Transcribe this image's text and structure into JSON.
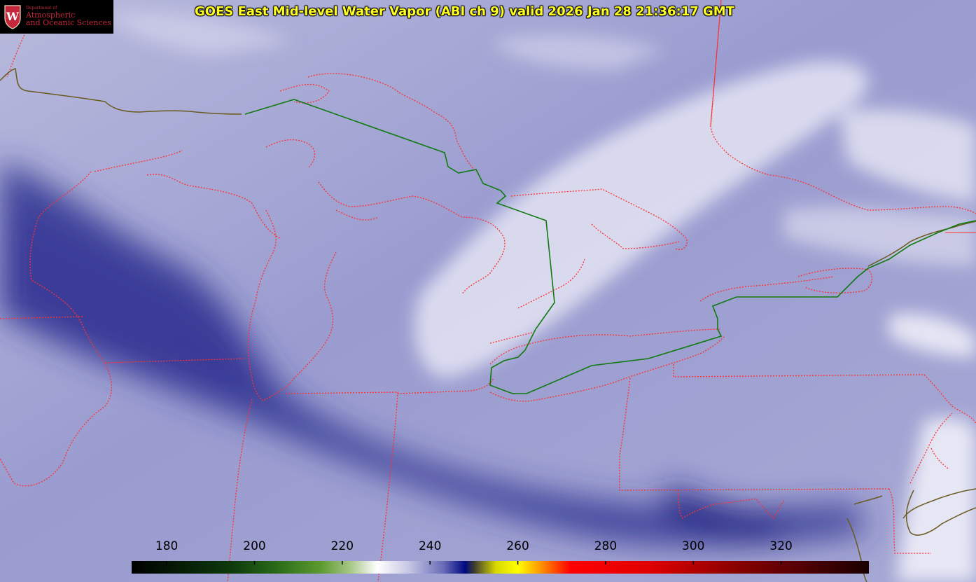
{
  "title": "GOES East Mid-level Water Vapor (ABI ch 9)  valid 2026 Jan 28 21:36:17 GMT",
  "logo": {
    "department": "Department of",
    "line1": "Atmospheric",
    "line2": "and Oceanic Sciences",
    "crest_letter": "W"
  },
  "colorbar": {
    "ticks": [
      "180",
      "200",
      "220",
      "240",
      "260",
      "280",
      "300",
      "320"
    ],
    "range": [
      172,
      340
    ],
    "stops": [
      {
        "v": 172,
        "c": "#000000"
      },
      {
        "v": 195,
        "c": "#0d3a0a"
      },
      {
        "v": 205,
        "c": "#2a6a1a"
      },
      {
        "v": 215,
        "c": "#5c9a2e"
      },
      {
        "v": 222,
        "c": "#a9c88a"
      },
      {
        "v": 228,
        "c": "#ffffff"
      },
      {
        "v": 235,
        "c": "#c7c8e4"
      },
      {
        "v": 243,
        "c": "#6a6cb8"
      },
      {
        "v": 248,
        "c": "#000a80"
      },
      {
        "v": 250,
        "c": "#3b3a30"
      },
      {
        "v": 255,
        "c": "#d8d800"
      },
      {
        "v": 260,
        "c": "#ffff00"
      },
      {
        "v": 265,
        "c": "#ff9900"
      },
      {
        "v": 272,
        "c": "#ff0000"
      },
      {
        "v": 290,
        "c": "#e00000"
      },
      {
        "v": 310,
        "c": "#880000"
      },
      {
        "v": 340,
        "c": "#1a0000"
      }
    ]
  },
  "colors": {
    "title_text": "#ffff22",
    "state_borders": "#ff3030",
    "international_border": "#107a10",
    "coastline": "#6a5a20",
    "background_vapor": "#8f91c8",
    "dry_band": "#2a2d8a",
    "moist_cloud": "#f2f2f8"
  }
}
